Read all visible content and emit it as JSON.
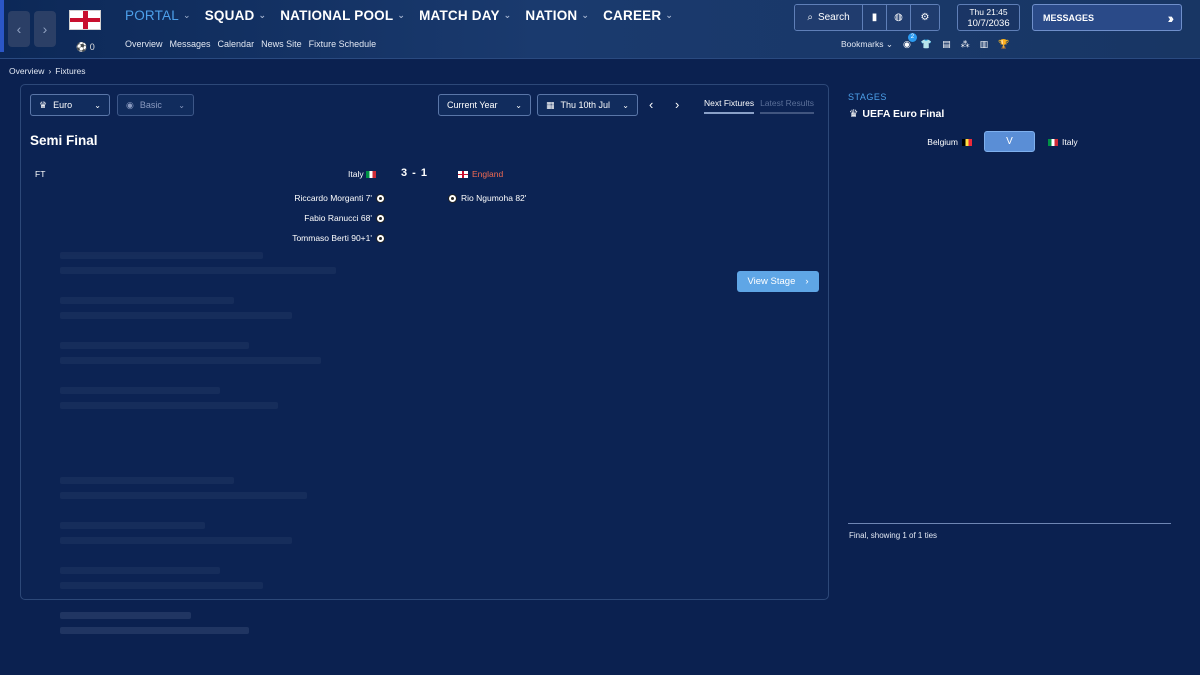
{
  "nav": {
    "back": "‹",
    "forward": "›",
    "club_label": "0",
    "menu": [
      {
        "label": "PORTAL",
        "active": true
      },
      {
        "label": "SQUAD"
      },
      {
        "label": "NATIONAL POOL"
      },
      {
        "label": "MATCH DAY"
      },
      {
        "label": "NATION"
      },
      {
        "label": "CAREER"
      }
    ],
    "submenu": [
      "Overview",
      "Messages",
      "Calendar",
      "News Site",
      "Fixture Schedule"
    ]
  },
  "toolbar": {
    "search_label": "Search",
    "date_time": "Thu 21:45",
    "date": "10/7/2036",
    "messages_label": "MESSAGES",
    "bookmarks_label": "Bookmarks",
    "bookmarks_badge": "2"
  },
  "breadcrumb": {
    "root": "Overview",
    "current": "Fixtures"
  },
  "filters": {
    "competition": "Euro",
    "view": "Basic",
    "period": "Current Year",
    "date": "Thu 10th Jul"
  },
  "tabs": {
    "next": "Next Fixtures",
    "latest": "Latest Results"
  },
  "fixture": {
    "title": "Semi Final",
    "status": "FT",
    "home": "Italy",
    "away": "England",
    "score": "3 - 1",
    "home_scorers": [
      "Riccardo Morganti 7'",
      "Fabio Ranucci 68'",
      "Tommaso Berti 90+1'"
    ],
    "away_scorers": [
      "Rio Ngumoha 82'"
    ],
    "view_stage_label": "View Stage"
  },
  "stages": {
    "heading": "STAGES",
    "name": "UEFA Euro Final",
    "home": "Belgium",
    "versus": "V",
    "away": "Italy",
    "summary": "Final, showing 1 of 1 ties"
  },
  "colors": {
    "accent": "#4da0ea",
    "away_team": "#f06a52",
    "button": "#5fa6e6"
  }
}
